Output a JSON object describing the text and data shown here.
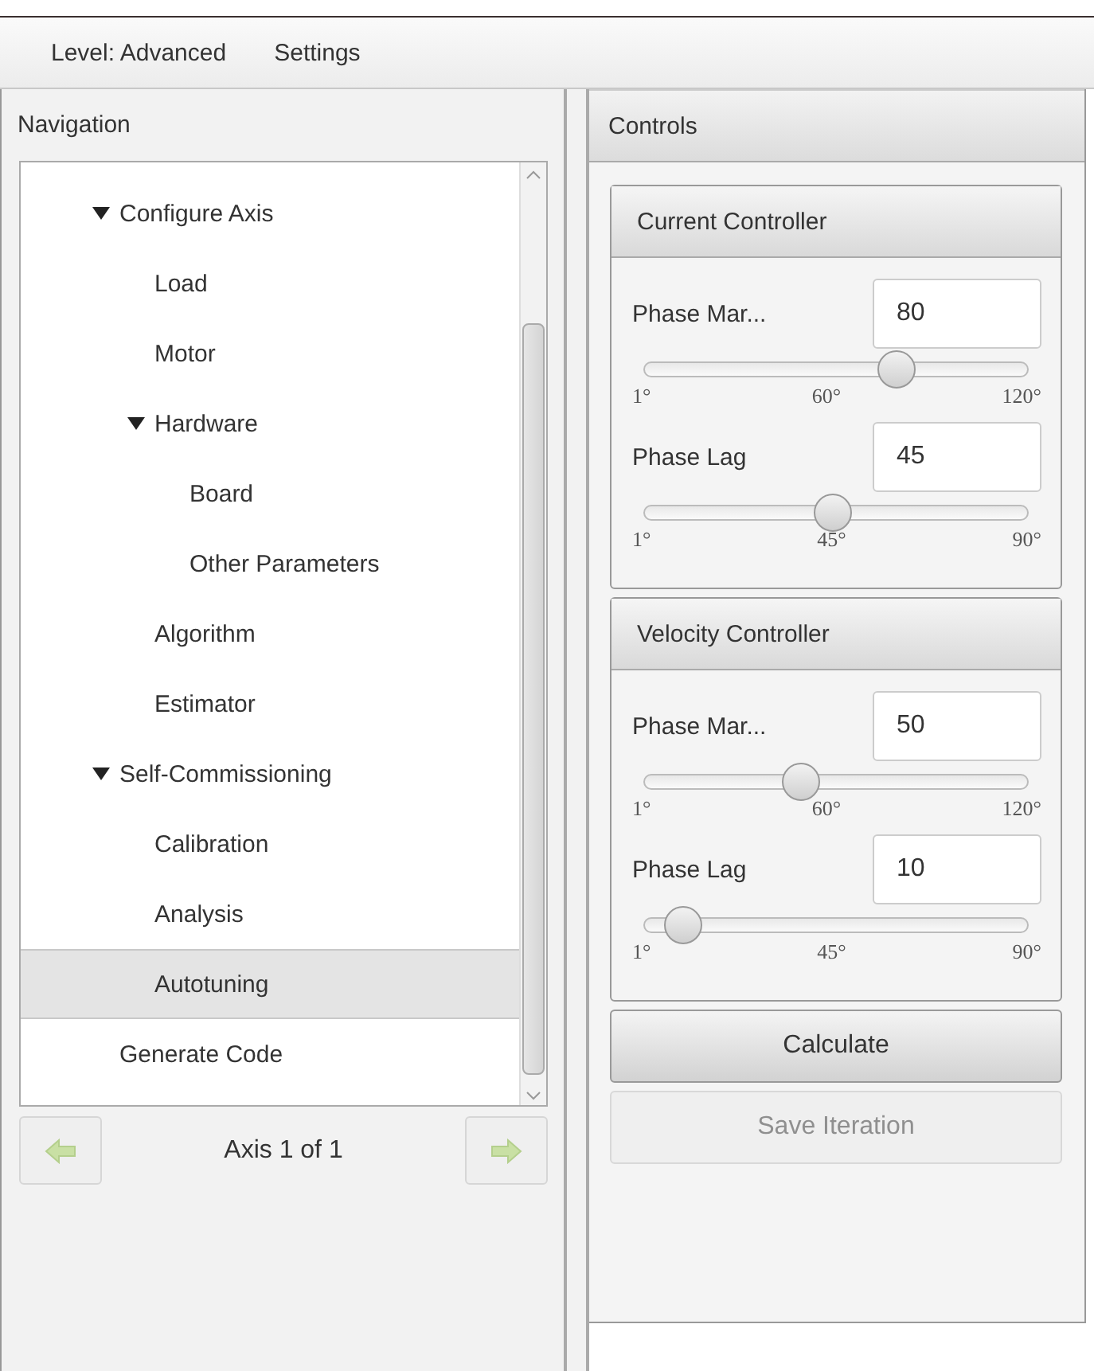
{
  "menu": [
    "Level: Advanced",
    "Settings"
  ],
  "navigation": {
    "title": "Navigation",
    "tree": [
      {
        "label": "Configure Axis",
        "expanded": true,
        "selected": false,
        "children": [
          {
            "label": "Load",
            "selected": false
          },
          {
            "label": "Motor",
            "selected": false
          },
          {
            "label": "Hardware",
            "expanded": true,
            "selected": false,
            "children": [
              {
                "label": "Board",
                "selected": false
              },
              {
                "label": "Other Parameters",
                "selected": false
              }
            ]
          },
          {
            "label": "Algorithm",
            "selected": false
          },
          {
            "label": "Estimator",
            "selected": false
          }
        ]
      },
      {
        "label": "Self-Commissioning",
        "expanded": true,
        "selected": false,
        "children": [
          {
            "label": "Calibration",
            "selected": false
          },
          {
            "label": "Analysis",
            "selected": false
          },
          {
            "label": "Autotuning",
            "selected": true
          }
        ]
      },
      {
        "label": "Generate Code",
        "selected": false
      }
    ],
    "pager": {
      "text": "Axis 1 of 1",
      "prev_disabled": true,
      "next_disabled": true
    }
  },
  "controls": {
    "title": "Controls",
    "groups": [
      {
        "title": "Current Controller",
        "params": [
          {
            "label": "Phase Mar...",
            "value": "80",
            "level": 0.66,
            "ticks": [
              "1°",
              "60°",
              "120°"
            ]
          },
          {
            "label": "Phase Lag",
            "value": "45",
            "level": 0.49,
            "ticks": [
              "1°",
              "45°",
              "90°"
            ]
          }
        ]
      },
      {
        "title": "Velocity Controller",
        "params": [
          {
            "label": "Phase Mar...",
            "value": "50",
            "level": 0.41,
            "ticks": [
              "1°",
              "60°",
              "120°"
            ]
          },
          {
            "label": "Phase Lag",
            "value": "10",
            "level": 0.1,
            "ticks": [
              "1°",
              "45°",
              "90°"
            ]
          }
        ]
      }
    ],
    "buttons": [
      {
        "label": "Calculate",
        "disabled": false
      },
      {
        "label": "Save Iteration",
        "disabled": true
      }
    ]
  }
}
